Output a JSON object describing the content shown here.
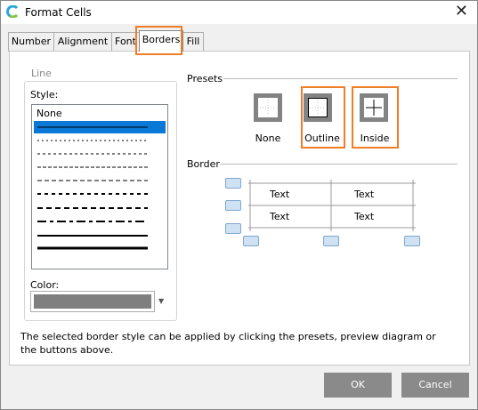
{
  "window": {
    "title": "Format Cells",
    "close_glyph": "✕"
  },
  "tabs": [
    {
      "label": "Number"
    },
    {
      "label": "Alignment"
    },
    {
      "label": "Font"
    },
    {
      "label": "Borders"
    },
    {
      "label": "Fill"
    }
  ],
  "active_tab": "Borders",
  "line": {
    "legend": "Line",
    "style_label": "Style:",
    "styles": [
      "None",
      "thin-solid",
      "hair",
      "dotted",
      "dash-dot",
      "dash-dot-dot",
      "medium-dashed",
      "medium-dash-dot",
      "medium-dash-dot-dot",
      "medium-solid",
      "thick-solid"
    ],
    "selected_style_index": 1,
    "color_label": "Color:",
    "color_value": "#7f7f7f"
  },
  "presets": {
    "label": "Presets",
    "items": [
      {
        "label": "None",
        "icon": "border-none-icon"
      },
      {
        "label": "Outline",
        "icon": "border-outline-icon"
      },
      {
        "label": "Inside",
        "icon": "border-inside-icon"
      }
    ]
  },
  "border": {
    "label": "Border",
    "cells": [
      "Text",
      "Text",
      "Text",
      "Text"
    ]
  },
  "status_text": "The selected border style can be applied by clicking the presets, preview diagram or the buttons above.",
  "buttons": {
    "ok": "OK",
    "cancel": "Cancel"
  },
  "colors": {
    "highlight": "#f07d28",
    "selection": "#0a78d7",
    "button": "#8a8a8a",
    "border_button": "#cfe2f3"
  }
}
